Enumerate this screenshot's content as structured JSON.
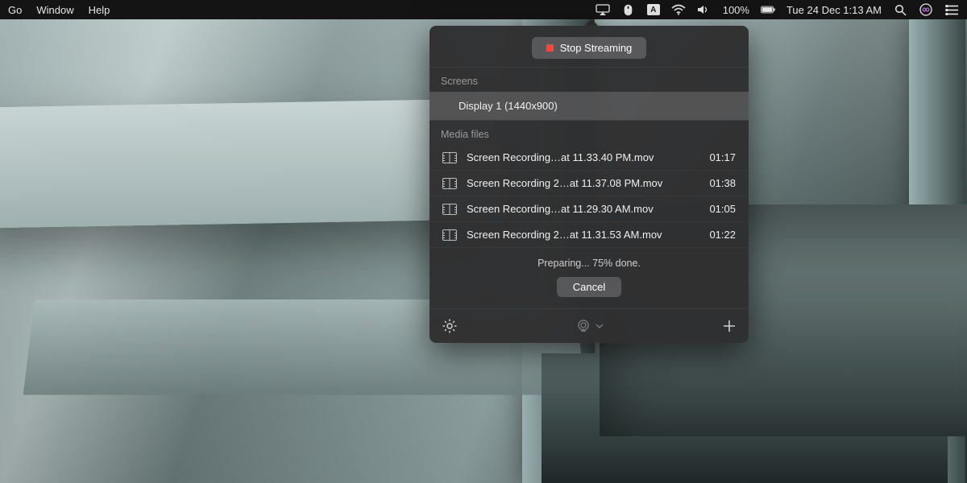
{
  "menubar": {
    "left": [
      "Go",
      "Window",
      "Help"
    ],
    "battery_pct": "100%",
    "datetime": "Tue 24 Dec  1:13 AM",
    "input_letter": "A"
  },
  "panel": {
    "stop_label": "Stop Streaming",
    "screens_label": "Screens",
    "display_label": "Display 1 (1440x900)",
    "media_label": "Media files",
    "media": [
      {
        "name": "Screen Recording…at 11.33.40 PM.mov",
        "duration": "01:17"
      },
      {
        "name": "Screen Recording 2…at 11.37.08 PM.mov",
        "duration": "01:38"
      },
      {
        "name": "Screen Recording…at 11.29.30 AM.mov",
        "duration": "01:05"
      },
      {
        "name": "Screen Recording 2…at 11.31.53 AM.mov",
        "duration": "01:22"
      }
    ],
    "status": "Preparing... 75% done.",
    "cancel_label": "Cancel"
  }
}
